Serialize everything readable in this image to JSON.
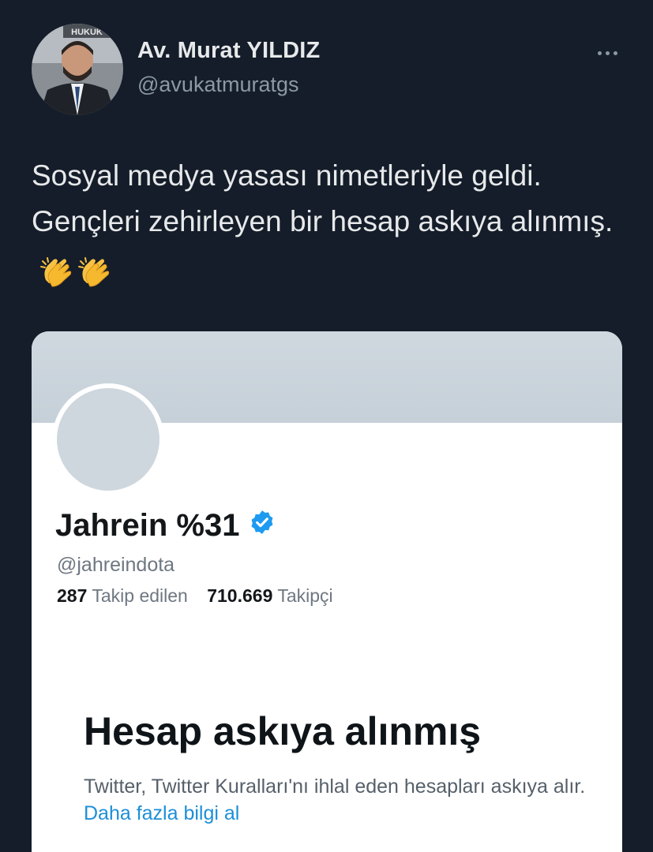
{
  "author": {
    "name": "Av. Murat YILDIZ",
    "handle": "@avukatmuratgs",
    "avatar_sign_text": "HUKUK"
  },
  "tweet": {
    "text": "Sosyal medya yasası nimetleriyle geldi. Gençleri zehirleyen bir hesap askıya alınmış.",
    "emojis": [
      "clapping-hands",
      "clapping-hands"
    ]
  },
  "embedded_profile": {
    "name": "Jahrein %31",
    "handle": "@jahreindota",
    "following_count": "287",
    "following_label": "Takip edilen",
    "followers_count": "710.669",
    "followers_label": "Takipçi",
    "suspended_title": "Hesap askıya alınmış",
    "suspended_desc": "Twitter, Twitter Kuralları'nı ihlal eden hesapları askıya alır.",
    "learn_more": "Daha fazla bilgi al"
  },
  "colors": {
    "background": "#151d2a",
    "primary_text": "#e7e9ea",
    "secondary_text": "#8b98a5",
    "link": "#1d8fd8",
    "verified": "#1d9bf0"
  }
}
